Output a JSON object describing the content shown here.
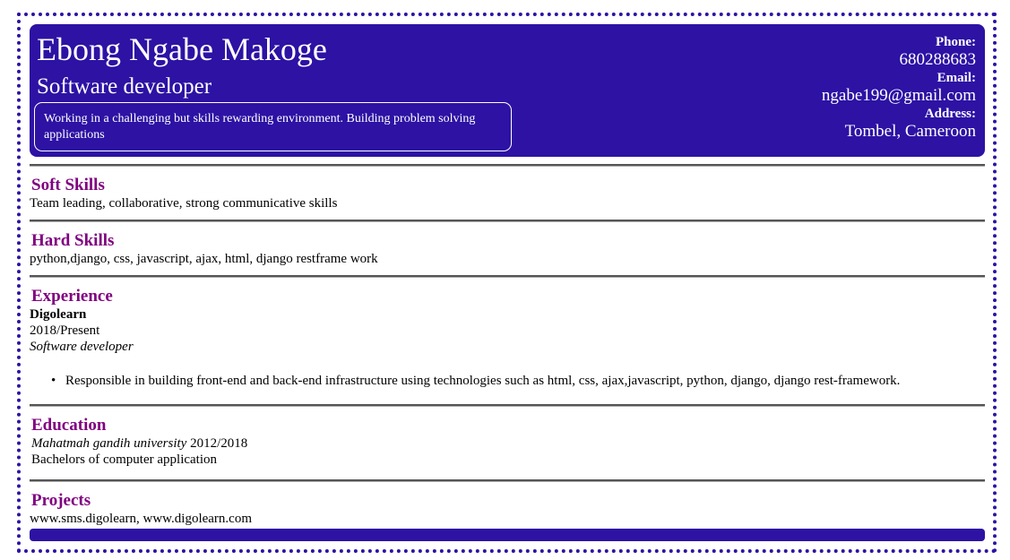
{
  "header": {
    "name": "Ebong Ngabe Makoge",
    "title": "Software developer",
    "objective": "Working in a challenging but skills rewarding environment. Building problem solving applications",
    "contact": {
      "phone_label": "Phone:",
      "phone": "680288683",
      "email_label": "Email:",
      "email": "ngabe199@gmail.com",
      "address_label": "Address:",
      "address": "Tombel, Cameroon"
    }
  },
  "sections": {
    "soft_skills": {
      "heading": "Soft Skills",
      "text": "Team leading, collaborative, strong communicative skills"
    },
    "hard_skills": {
      "heading": "Hard Skills",
      "text": "python,django, css, javascript, ajax, html, django restframe work"
    },
    "experience": {
      "heading": "Experience",
      "company": "Digolearn",
      "period": "2018/Present",
      "role": "Software developer",
      "bullet_glyph": "•",
      "responsibilities": [
        "Responsible in building front-end and back-end infrastructure using technologies such as html, css, ajax,javascript, python, django, django rest-framework."
      ]
    },
    "education": {
      "heading": "Education",
      "institution": "Mahatmah gandih university",
      "period": "2012/2018",
      "degree": "Bachelors of computer application"
    },
    "projects": {
      "heading": "Projects",
      "text": "www.sms.digolearn, www.digolearn.com"
    }
  },
  "colors": {
    "accent": "#2d12a4",
    "heading": "#800080",
    "divider": "#555555"
  }
}
